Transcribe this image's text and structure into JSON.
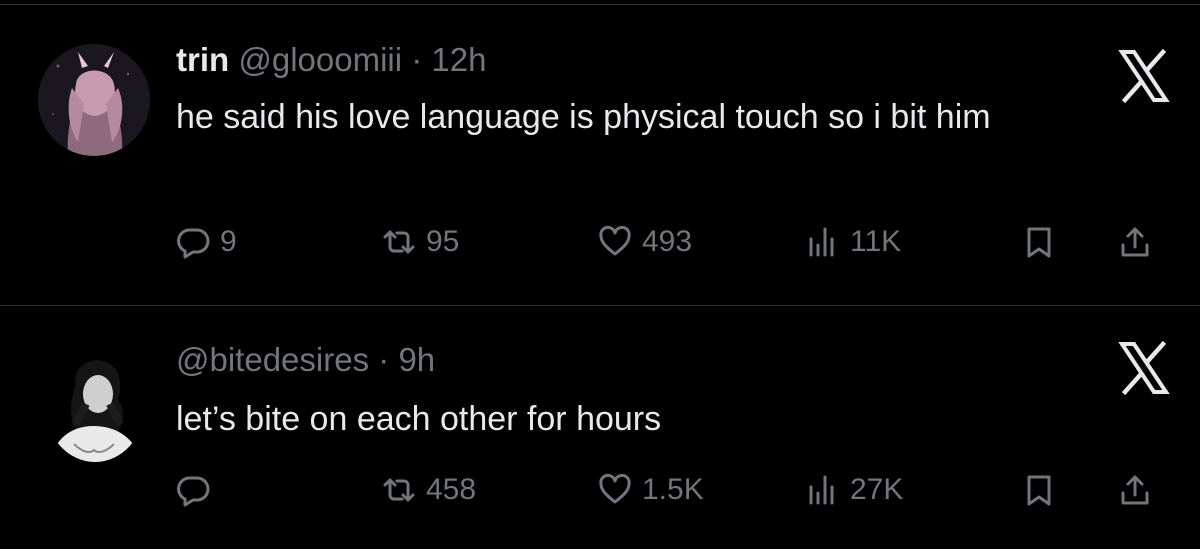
{
  "tweets": [
    {
      "display_name": "trin",
      "handle": "@glooomiii",
      "separator": "·",
      "time": "12h",
      "text": "he said his love language is physical touch so i bit him",
      "metrics": {
        "replies": "9",
        "reposts": "95",
        "likes": "493",
        "views": "11K"
      }
    },
    {
      "display_name": "",
      "handle": "@bitedesires",
      "separator": "·",
      "time": "9h",
      "text": "let’s bite on each other for hours",
      "metrics": {
        "replies": "",
        "reposts": "458",
        "likes": "1.5K",
        "views": "27K"
      }
    }
  ],
  "icons": {
    "brand": "x-logo-icon",
    "reply": "reply-bubble-icon",
    "repost": "repost-arrows-icon",
    "like": "heart-icon",
    "views": "views-bars-icon",
    "bookmark": "bookmark-icon",
    "share": "share-upload-icon"
  },
  "colors": {
    "background": "#000000",
    "text": "#e7e9ea",
    "muted": "#71767b",
    "divider": "#2f3336"
  }
}
